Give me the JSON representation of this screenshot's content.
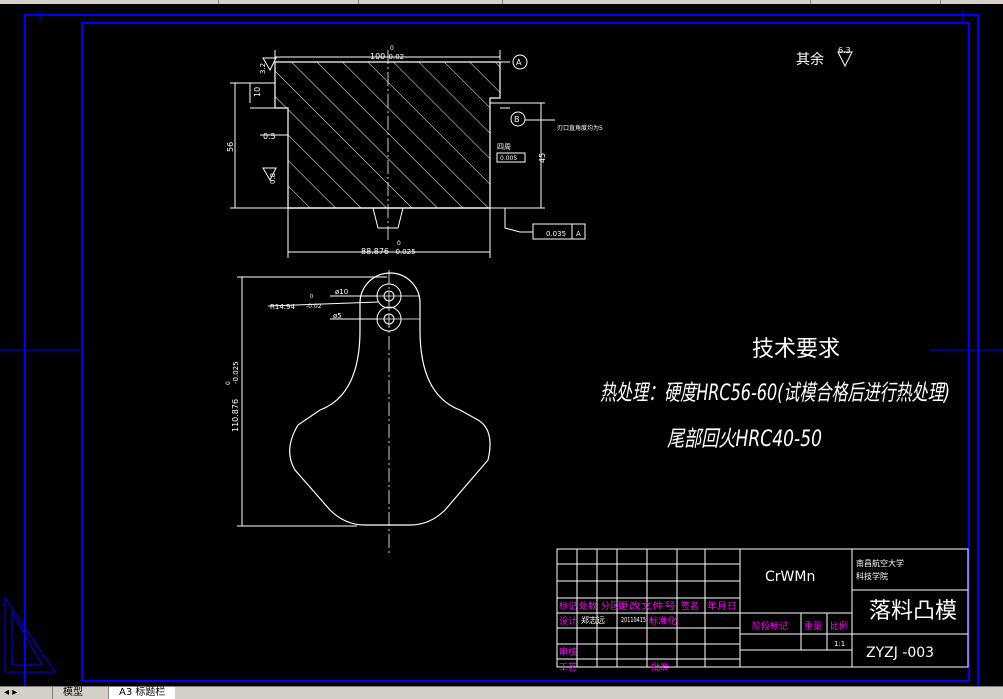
{
  "drawing": {
    "top_view": {
      "width_dim": "100",
      "width_tol_upper": "0",
      "width_tol_lower": "-0.02",
      "bottom_width_dim": "88.876",
      "bottom_width_tol_upper": "0",
      "bottom_width_tol_lower": "-0.025",
      "height_dim": "56",
      "inner_height_dim": "45",
      "step_dim": "10",
      "offset_dim": "0.5",
      "roughness_top": "3.2",
      "roughness_side": "0.8",
      "datum_a": "A",
      "datum_b": "B",
      "note_side": "刃口直角度均为5",
      "note_around": "四周",
      "small_tol_box": "0.005",
      "geom_tol_value": "0.035",
      "geom_tol_datum": "A"
    },
    "plan_view": {
      "radius_dim": "R14.94",
      "radius_tol_upper": "0",
      "radius_tol_lower": "-0.02",
      "hole1_dim": "ø10",
      "hole2_dim": "ø5",
      "length_dim": "110.876",
      "length_tol_upper": "0",
      "length_tol_lower": "-0.025"
    },
    "roughness_rest_label": "其余",
    "roughness_rest_value": "6.3",
    "tech_title": "技术要求",
    "tech_line1": "热处理：硬度HRC56-60(试模合格后进行热处理)",
    "tech_line2": "尾部回火HRC40-50"
  },
  "title_block": {
    "material": "CrWMn",
    "org_line1": "南昌航空大学",
    "org_line2": "科技学院",
    "part_name": "落料凸模",
    "drawing_no": "ZYZJ -003",
    "headers": [
      "标记",
      "处数",
      "分区",
      "更改文件号",
      "签名",
      "年月日"
    ],
    "row_design": "设计",
    "designer": "郑志远",
    "design_date": "20110415",
    "standardize": "标准化",
    "stage_mark": "阶段标记",
    "weight": "重量",
    "scale_label": "比例",
    "scale_value": "1:1",
    "review": "审核",
    "process": "工艺",
    "approve": "批准"
  },
  "tabs": {
    "model": "模型",
    "layout": "A3 标题栏"
  },
  "colors": {
    "background": "#000000",
    "frame": "#0000ff",
    "lines": "#ffffff",
    "labels": "#ff00ff"
  }
}
